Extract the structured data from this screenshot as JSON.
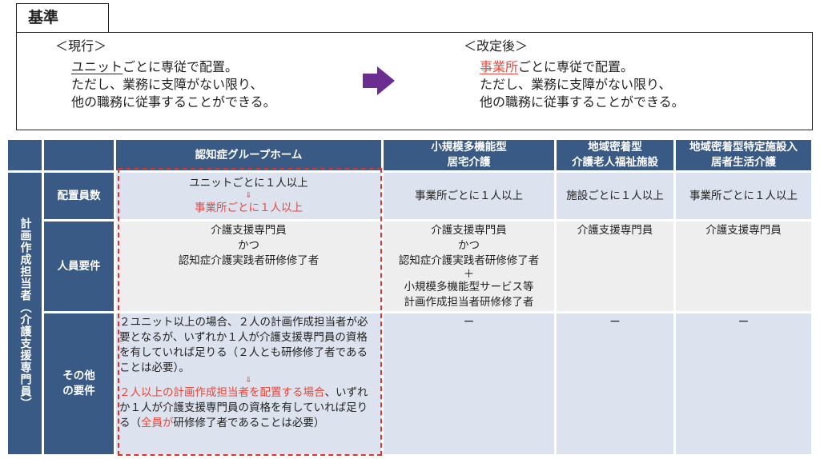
{
  "title": "基準",
  "current": {
    "heading": "＜現行＞",
    "underlined": "ユニット",
    "line1_rest": "ごとに専従で配置。",
    "line2": "ただし、業務に支障がない限り、",
    "line3": "他の職務に従事することができる。"
  },
  "revised": {
    "heading": "＜改定後＞",
    "underlined": "事業所",
    "line1_rest": "ごとに専従で配置。",
    "line2": "ただし、業務に支障がない限り、",
    "line3": "他の職務に従事することができる。"
  },
  "arrow_color": "#6b2d8f",
  "accent_red": "#e8473c",
  "header_blue": "#3a5a86",
  "table": {
    "side_label": "計画作成担当者（介護支援専門員）",
    "columns": [
      "認知症グループホーム",
      "小規模多機能型\n居宅介護",
      "地域密着型\n介護老人福祉施設",
      "地域密着型特定施設入\n居者生活介護"
    ],
    "rows": {
      "staffing": {
        "label": "配置員数",
        "gh_line1": "ユニットごとに１人以上",
        "gh_arrow": "⇓",
        "gh_line2": "事業所ごとに１人以上",
        "c2": "事業所ごとに１人以上",
        "c3": "施設ごとに１人以上",
        "c4": "事業所ごとに１人以上"
      },
      "personnel": {
        "label": "人員要件",
        "gh_line1": "介護支援専門員",
        "gh_line2": "かつ",
        "gh_line3": "認知症介護実践者研修修了者",
        "c2_line1": "介護支援専門員",
        "c2_line2": "かつ",
        "c2_line3": "認知症介護実践者研修修了者",
        "c2_line4": "＋",
        "c2_line5": "小規模多機能型サービス等",
        "c2_line6": "計画作成担当者研修修了者",
        "c3": "介護支援専門員",
        "c4": "介護支援専門員"
      },
      "other": {
        "label": "その他\nの要件",
        "gh_before": "２ユニット以上の場合、２人の計画作成担当者が必要となるが、いずれか１人が介護支援専門員の資格を有していれば足りる（２人とも研修修了者であることは必要）。",
        "gh_arrow": "⇓",
        "gh_after_red": "２人以上の計画作成担当者を配置する場合",
        "gh_after_1": "、いずれか１人が介護支援専門員の資格を有していれば足りる（",
        "gh_after_red2": "全員が",
        "gh_after_2": "研修修了者であることは必要）",
        "c2": "ー",
        "c3": "ー",
        "c4": "ー"
      }
    }
  }
}
